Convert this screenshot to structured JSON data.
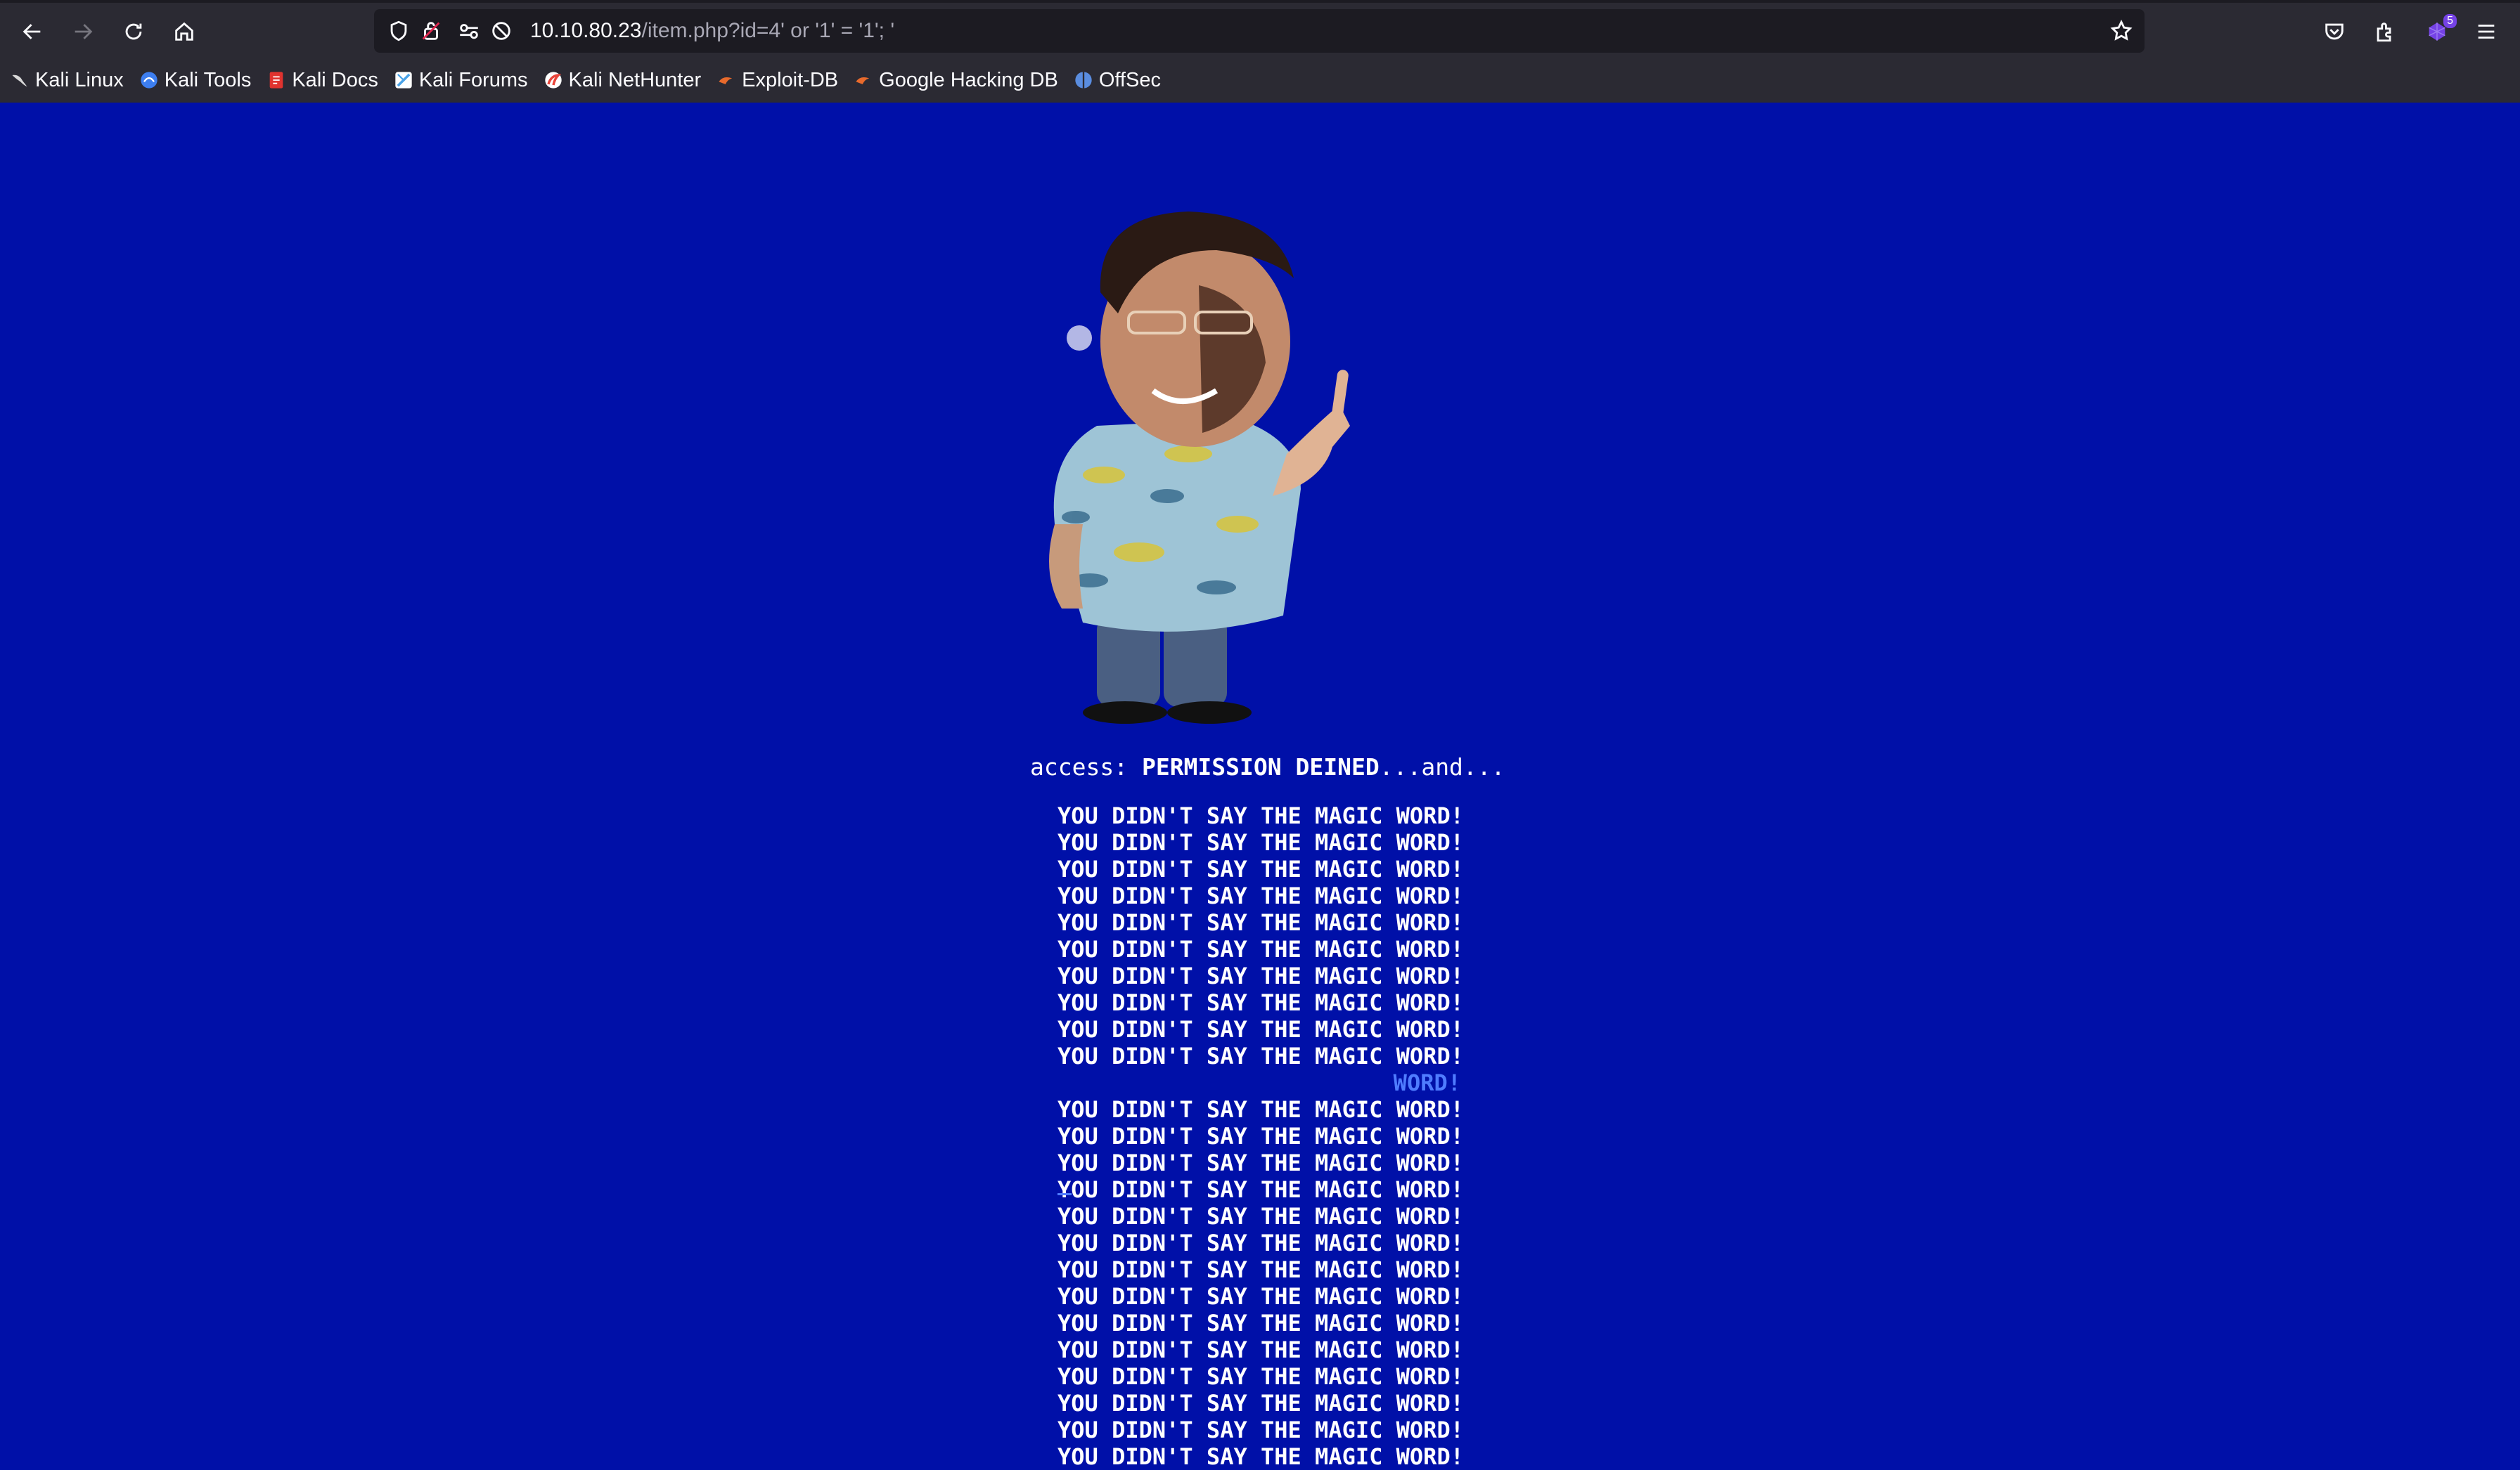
{
  "browser": {
    "url_host": "10.10.80.23",
    "url_rest": "/item.php?id=4' or '1' = '1'; '",
    "extension_badge": "5",
    "bookmarks": [
      {
        "label": "Kali Linux",
        "icon": "kali-dragon-icon",
        "color": "#d0d0d0"
      },
      {
        "label": "Kali Tools",
        "icon": "kali-tools-icon",
        "color": "#3d7ef0"
      },
      {
        "label": "Kali Docs",
        "icon": "kali-docs-icon",
        "color": "#e0332f"
      },
      {
        "label": "Kali Forums",
        "icon": "kali-forums-icon",
        "color": "#4aa3e8"
      },
      {
        "label": "Kali NetHunter",
        "icon": "nethunter-icon",
        "color": "#e8443a"
      },
      {
        "label": "Exploit-DB",
        "icon": "exploit-db-icon",
        "color": "#e86a2c"
      },
      {
        "label": "Google Hacking DB",
        "icon": "ghdb-icon",
        "color": "#e86a2c"
      },
      {
        "label": "OffSec",
        "icon": "offsec-icon",
        "color": "#5a8de0"
      }
    ]
  },
  "page": {
    "background_color": "#0010a8",
    "access_prefix": "access: ",
    "access_status": "PERMISSION DEINED",
    "access_suffix": "...and...",
    "magic_lines": [
      "YOU DIDN'T SAY THE MAGIC WORD!",
      "YOU DIDN'T SAY THE MAGIC WORD!",
      "YOU DIDN'T SAY THE MAGIC WORD!",
      "YOU DIDN'T SAY THE MAGIC WORD!",
      "YOU DIDN'T SAY THE MAGIC WORD!",
      "YOU DIDN'T SAY THE MAGIC WORD!",
      "YOU DIDN'T SAY THE MAGIC WORD!",
      "YOU DIDN'T SAY THE MAGIC WORD!",
      "YOU DIDN'T SAY THE MAGIC WORD!",
      "YOU DIDN'T SAY THE MAGIC WORD!",
      "WORD!",
      "YOU DIDN'T SAY THE MAGIC WORD!",
      "YOU DIDN'T SAY THE MAGIC WORD!",
      "YOU DIDN'T SAY THE MAGIC WORD!",
      "YOU DIDN'T SAY THE MAGIC WORD!",
      "YOU DIDN'T SAY THE MAGIC WORD!",
      "YOU DIDN'T SAY THE MAGIC WORD!",
      "YOU DIDN'T SAY THE MAGIC WORD!",
      "YOU DIDN'T SAY THE MAGIC WORD!",
      "YOU DIDN'T SAY THE MAGIC WORD!",
      "YOU DIDN'T SAY THE MAGIC WORD!",
      "YOU DIDN'T SAY THE MAGIC WORD!",
      "YOU DIDN'T SAY THE MAGIC WORD!",
      "YOU DIDN'T SAY THE MAGIC WORD!",
      "YOU DIDN'T SAY THE MAGIC WORD!"
    ]
  }
}
